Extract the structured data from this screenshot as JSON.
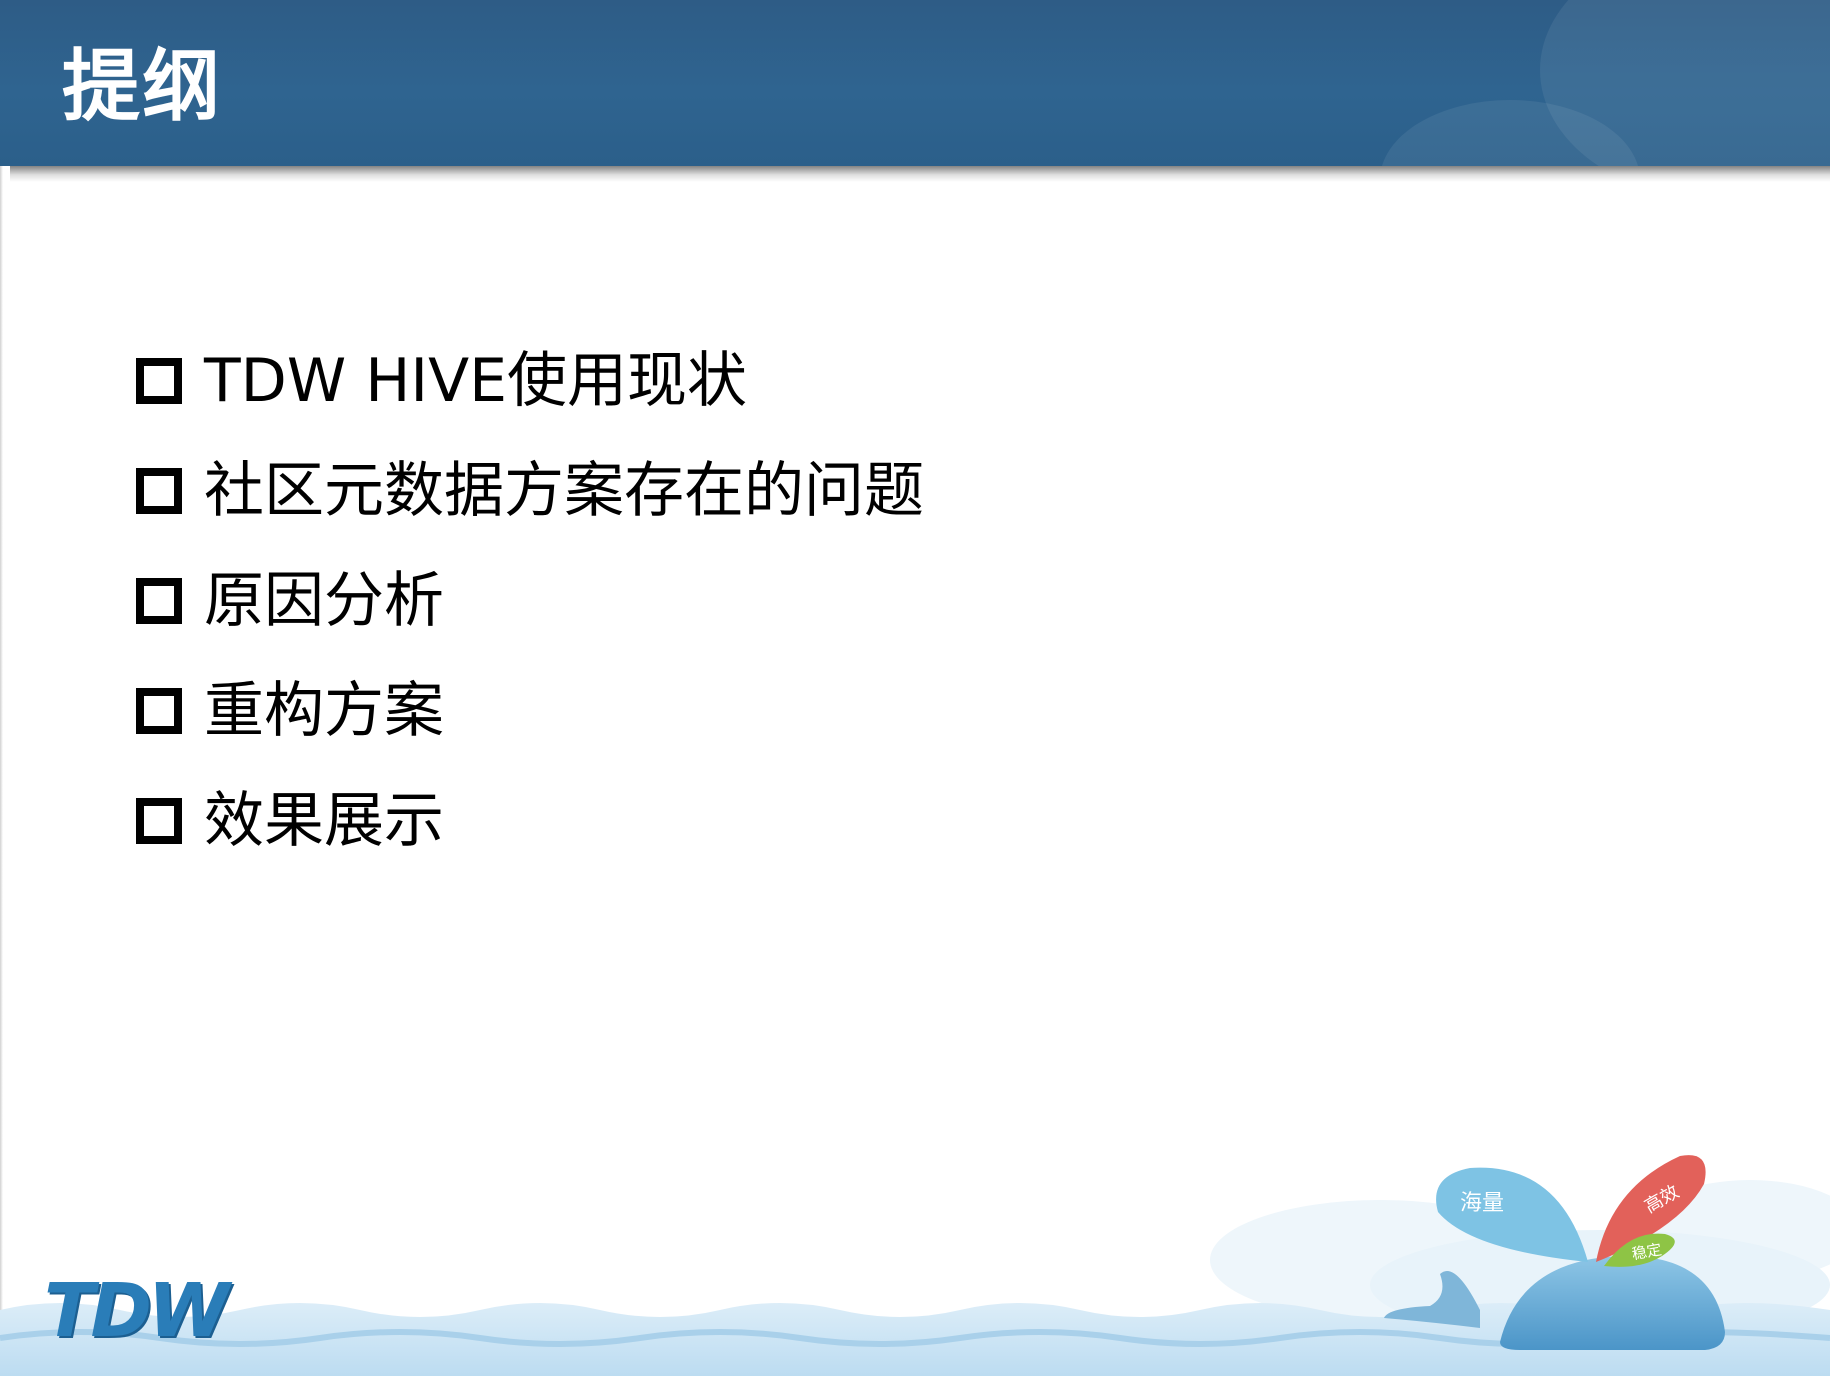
{
  "slide": {
    "title": "提纲",
    "bullets": [
      {
        "text": "TDW HIVE使用现状"
      },
      {
        "text": "社区元数据方案存在的问题"
      },
      {
        "text": "原因分析"
      },
      {
        "text": "重构方案"
      },
      {
        "text": "效果展示"
      }
    ]
  },
  "footer": {
    "logo_text": "TDW",
    "splash_labels": [
      "海量",
      "高效",
      "稳定"
    ]
  },
  "colors": {
    "title_bar": "#2e5c86",
    "title_text": "#ffffff",
    "bullet_text": "#000000",
    "logo": "#2a7db8",
    "splash_blue": "#7ec3e4",
    "splash_red": "#e2615a",
    "splash_green": "#8ec445",
    "whale": "#6aaed6"
  }
}
